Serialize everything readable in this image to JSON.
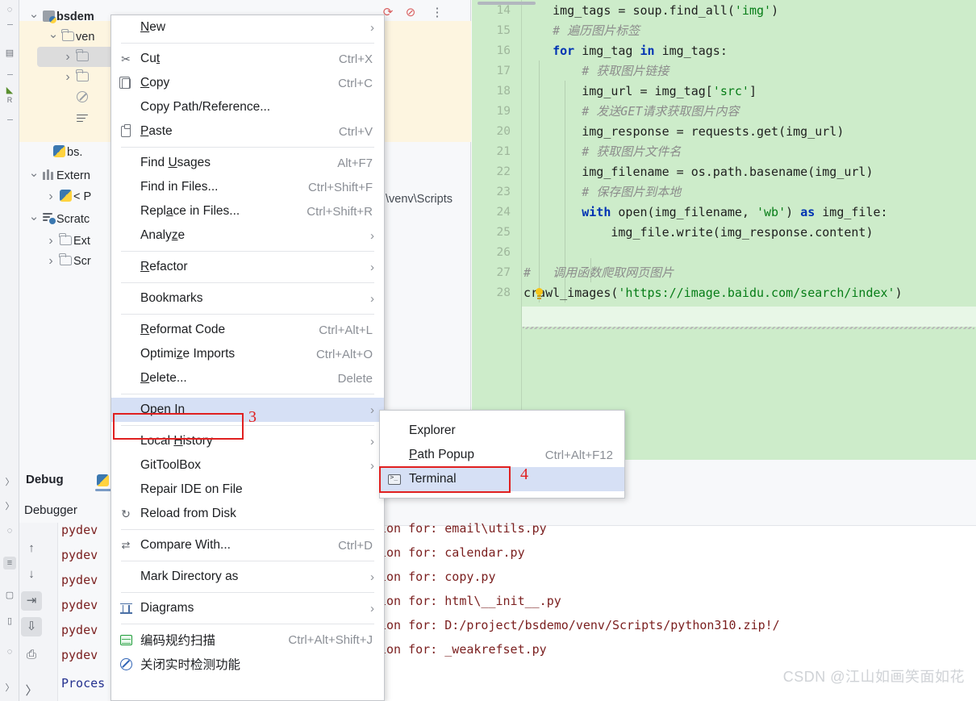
{
  "app": {
    "watermark": "CSDN @江山如画笑面如花"
  },
  "project_tree": {
    "rows": [
      {
        "label": "bsdem",
        "icon": "module-icon",
        "indent": 0,
        "expanded": true,
        "bold": true
      },
      {
        "label": "ven",
        "icon": "folder-icon",
        "indent": 1,
        "expanded": true,
        "bold": false
      },
      {
        "label": "",
        "icon": "folder-icon",
        "indent": 2,
        "expanded": false,
        "bold": false,
        "selected": true
      },
      {
        "label": "",
        "icon": "folder-icon",
        "indent": 2,
        "expanded": false,
        "bold": false
      },
      {
        "label": "",
        "icon": "blocked-icon",
        "indent": 2,
        "expanded": null,
        "bold": false
      },
      {
        "label": "",
        "icon": "text-lines-icon",
        "indent": 2,
        "expanded": null,
        "bold": false
      },
      {
        "label": "bs.",
        "icon": "python-file-icon",
        "indent": 1,
        "expanded": null,
        "bold": false
      },
      {
        "label": "Extern",
        "icon": "library-icon",
        "indent": 0,
        "expanded": true,
        "bold": false
      },
      {
        "label": "< P",
        "icon": "python-file-icon",
        "indent": 1,
        "expanded": false,
        "bold": false
      },
      {
        "label": "Scratc",
        "icon": "scratches-icon",
        "indent": 0,
        "expanded": true,
        "bold": false
      },
      {
        "label": "Ext",
        "icon": "folder-icon",
        "indent": 1,
        "expanded": false,
        "bold": false
      },
      {
        "label": "Scr",
        "icon": "folder-icon",
        "indent": 1,
        "expanded": false,
        "bold": false
      }
    ],
    "path_fragment": "\\venv\\Scripts"
  },
  "context_menu": {
    "items": [
      {
        "label": "New",
        "underline": "N",
        "shortcut": "",
        "arrow": true,
        "icon": ""
      },
      {
        "sep": true
      },
      {
        "label": "Cut",
        "underline": "t",
        "shortcut": "Ctrl+X",
        "arrow": false,
        "icon": "scissors-icon"
      },
      {
        "label": "Copy",
        "underline": "C",
        "shortcut": "Ctrl+C",
        "arrow": false,
        "icon": "copy-icon"
      },
      {
        "label": "Copy Path/Reference...",
        "underline": "",
        "shortcut": "",
        "arrow": false,
        "icon": ""
      },
      {
        "label": "Paste",
        "underline": "P",
        "shortcut": "Ctrl+V",
        "arrow": false,
        "icon": "paste-icon"
      },
      {
        "sep": true
      },
      {
        "label": "Find Usages",
        "underline": "U",
        "shortcut": "Alt+F7",
        "arrow": false,
        "icon": ""
      },
      {
        "label": "Find in Files...",
        "underline": "",
        "shortcut": "Ctrl+Shift+F",
        "arrow": false,
        "icon": ""
      },
      {
        "label": "Replace in Files...",
        "underline": "a",
        "shortcut": "Ctrl+Shift+R",
        "arrow": false,
        "icon": ""
      },
      {
        "label": "Analyze",
        "underline": "z",
        "shortcut": "",
        "arrow": true,
        "icon": ""
      },
      {
        "sep": true
      },
      {
        "label": "Refactor",
        "underline": "R",
        "shortcut": "",
        "arrow": true,
        "icon": ""
      },
      {
        "sep": true
      },
      {
        "label": "Bookmarks",
        "underline": "",
        "shortcut": "",
        "arrow": true,
        "icon": ""
      },
      {
        "sep": true
      },
      {
        "label": "Reformat Code",
        "underline": "R",
        "shortcut": "Ctrl+Alt+L",
        "arrow": false,
        "icon": ""
      },
      {
        "label": "Optimize Imports",
        "underline": "z",
        "shortcut": "Ctrl+Alt+O",
        "arrow": false,
        "icon": ""
      },
      {
        "label": "Delete...",
        "underline": "D",
        "shortcut": "Delete",
        "arrow": false,
        "icon": ""
      },
      {
        "sep": true
      },
      {
        "label": "Open In",
        "underline": "",
        "shortcut": "",
        "arrow": true,
        "icon": "",
        "highlight": true
      },
      {
        "sep": true
      },
      {
        "label": "Local History",
        "underline": "H",
        "shortcut": "",
        "arrow": true,
        "icon": ""
      },
      {
        "label": "GitToolBox",
        "underline": "",
        "shortcut": "",
        "arrow": true,
        "icon": ""
      },
      {
        "label": "Repair IDE on File",
        "underline": "",
        "shortcut": "",
        "arrow": false,
        "icon": ""
      },
      {
        "label": "Reload from Disk",
        "underline": "",
        "shortcut": "",
        "arrow": false,
        "icon": "reload-icon"
      },
      {
        "sep": true
      },
      {
        "label": "Compare With...",
        "underline": "",
        "shortcut": "Ctrl+D",
        "arrow": false,
        "icon": "compare-icon"
      },
      {
        "sep": true
      },
      {
        "label": "Mark Directory as",
        "underline": "",
        "shortcut": "",
        "arrow": true,
        "icon": ""
      },
      {
        "sep": true
      },
      {
        "label": "Diagrams",
        "underline": "",
        "shortcut": "",
        "arrow": true,
        "icon": "diagram-icon"
      },
      {
        "sep": true
      },
      {
        "label": "编码规约扫描",
        "underline": "",
        "shortcut": "Ctrl+Alt+Shift+J",
        "arrow": false,
        "icon": "scan-icon"
      },
      {
        "label": "关闭实时检测功能",
        "underline": "",
        "shortcut": "",
        "arrow": false,
        "icon": "stop-icon"
      }
    ]
  },
  "submenu": {
    "items": [
      {
        "label": "Explorer",
        "underline": "",
        "shortcut": "",
        "icon": ""
      },
      {
        "label": "Path Popup",
        "underline": "P",
        "shortcut": "Ctrl+Alt+F12",
        "icon": ""
      },
      {
        "label": "Terminal",
        "underline": "",
        "shortcut": "",
        "icon": "terminal-icon",
        "highlight": true
      }
    ]
  },
  "annotations": [
    {
      "number": "3",
      "target": "Open In"
    },
    {
      "number": "4",
      "target": "Terminal"
    }
  ],
  "editor": {
    "lines": [
      {
        "num": "14",
        "segments": [
          {
            "t": "    ",
            "c": "pl"
          },
          {
            "t": "img_tags = soup.find_all(",
            "c": "pl"
          },
          {
            "t": "'img'",
            "c": "str"
          },
          {
            "t": ")",
            "c": "pl"
          }
        ]
      },
      {
        "num": "15",
        "segments": [
          {
            "t": "    # 遍历图片标签",
            "c": "cm"
          }
        ]
      },
      {
        "num": "16",
        "segments": [
          {
            "t": "    ",
            "c": "pl"
          },
          {
            "t": "for",
            "c": "kw"
          },
          {
            "t": " img_tag ",
            "c": "pl"
          },
          {
            "t": "in",
            "c": "kw"
          },
          {
            "t": " img_tags:",
            "c": "pl"
          }
        ]
      },
      {
        "num": "17",
        "segments": [
          {
            "t": "        # 获取图片链接",
            "c": "cm"
          }
        ]
      },
      {
        "num": "18",
        "segments": [
          {
            "t": "        img_url = img_tag[",
            "c": "pl"
          },
          {
            "t": "'src'",
            "c": "str"
          },
          {
            "t": "]",
            "c": "pl"
          }
        ]
      },
      {
        "num": "19",
        "segments": [
          {
            "t": "        # 发送GET请求获取图片内容",
            "c": "cm"
          }
        ]
      },
      {
        "num": "20",
        "segments": [
          {
            "t": "        img_response = requests.get(img_url)",
            "c": "pl"
          }
        ]
      },
      {
        "num": "21",
        "segments": [
          {
            "t": "        # 获取图片文件名",
            "c": "cm"
          }
        ]
      },
      {
        "num": "22",
        "segments": [
          {
            "t": "        img_filename = os.path.basename(img_url)",
            "c": "pl"
          }
        ]
      },
      {
        "num": "23",
        "segments": [
          {
            "t": "        # 保存图片到本地",
            "c": "cm"
          }
        ]
      },
      {
        "num": "24",
        "segments": [
          {
            "t": "        ",
            "c": "pl"
          },
          {
            "t": "with",
            "c": "kw"
          },
          {
            "t": " open(img_filename, ",
            "c": "pl"
          },
          {
            "t": "'wb'",
            "c": "str"
          },
          {
            "t": ") ",
            "c": "pl"
          },
          {
            "t": "as",
            "c": "kw"
          },
          {
            "t": " img_file:",
            "c": "pl"
          }
        ]
      },
      {
        "num": "25",
        "segments": [
          {
            "t": "            img_file.write(img_response.content)",
            "c": "pl"
          }
        ]
      },
      {
        "num": "26",
        "segments": [
          {
            "t": "",
            "c": "pl"
          }
        ]
      },
      {
        "num": "27",
        "segments": [
          {
            "t": "#",
            "c": "cm"
          },
          {
            "t": "   调用函数爬取网页图片",
            "c": "cm"
          }
        ]
      },
      {
        "num": "28",
        "segments": [
          {
            "t": "crawl_images(",
            "c": "pl"
          },
          {
            "t": "'https://image.baidu.com/search/index'",
            "c": "str"
          },
          {
            "t": ")",
            "c": "pl"
          }
        ]
      }
    ]
  },
  "debug_panel": {
    "title": "Debug",
    "tab": "Debugger",
    "buttons": [
      "step-up-icon",
      "step-down-icon",
      "step-into-icon",
      "step-out-icon",
      "print-icon",
      "expand-icon"
    ],
    "lines": [
      "pydev",
      "pydev",
      "pydev",
      "pydev",
      "pydev",
      "pydev"
    ],
    "process_line": "Proces"
  },
  "run_output": {
    "toolbar_icons": [
      "rerun-icon",
      "suppress-icon",
      "more-options-icon"
    ],
    "lines": [
      "ion for: email\\utils.py",
      "ion for: calendar.py",
      "ion for: copy.py",
      "ion for: html\\__init__.py",
      "ion for: D:/project/bsdemo/venv/Scripts/python310.zip!/",
      "ion for: _weakrefset.py"
    ]
  }
}
